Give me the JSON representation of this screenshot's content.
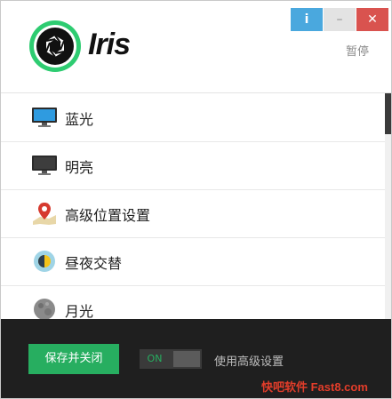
{
  "app": {
    "brand": "Iris"
  },
  "header": {
    "pause_label": "暂停"
  },
  "window_buttons": {
    "info": "i",
    "minimize": "–",
    "close": "✕"
  },
  "presets": [
    {
      "label": "蓝光",
      "icon": "monitor-blue-icon"
    },
    {
      "label": "明亮",
      "icon": "monitor-dark-icon"
    },
    {
      "label": "高级位置设置",
      "icon": "map-pin-icon"
    },
    {
      "label": "昼夜交替",
      "icon": "day-night-icon"
    },
    {
      "label": "月光",
      "icon": "moon-icon"
    }
  ],
  "footer": {
    "save_close_label": "保存并关闭",
    "toggle_state": "ON",
    "advanced_label": "使用高级设置",
    "watermark": "快吧软件 Fast8.com"
  },
  "colors": {
    "accent_green": "#27ae60",
    "info_blue": "#4aa8de",
    "close_red": "#d9534f",
    "footer_bg": "#1f1f1f"
  }
}
